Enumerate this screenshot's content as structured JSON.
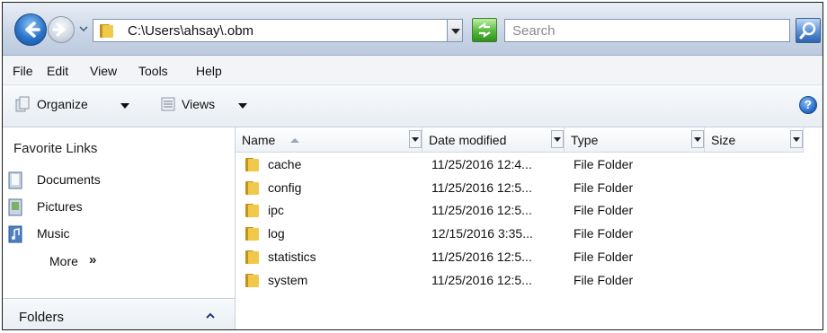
{
  "address_bar": {
    "path": "C:\\Users\\ahsay\\.obm",
    "search_placeholder": "Search"
  },
  "menu": [
    "File",
    "Edit",
    "View",
    "Tools",
    "Help"
  ],
  "toolbar": {
    "organize_label": "Organize",
    "views_label": "Views"
  },
  "nav_pane": {
    "favorites_title": "Favorite Links",
    "links": [
      "Documents",
      "Pictures",
      "Music"
    ],
    "more_label": "More",
    "more_chevron": "»",
    "folders_label": "Folders"
  },
  "columns": [
    "Name",
    "Date modified",
    "Type",
    "Size"
  ],
  "files": [
    {
      "name": "cache",
      "date": "11/25/2016 12:4...",
      "type": "File Folder"
    },
    {
      "name": "config",
      "date": "11/25/2016 12:5...",
      "type": "File Folder"
    },
    {
      "name": "ipc",
      "date": "11/25/2016 12:5...",
      "type": "File Folder"
    },
    {
      "name": "log",
      "date": "12/15/2016 3:35...",
      "type": "File Folder"
    },
    {
      "name": "statistics",
      "date": "11/25/2016 12:5...",
      "type": "File Folder"
    },
    {
      "name": "system",
      "date": "11/25/2016 12:5...",
      "type": "File Folder"
    }
  ],
  "colors": {
    "chrome_top": "#e9eef5",
    "chrome_bottom": "#bccadf",
    "folder": "#e8b830",
    "accent_blue": "#2a73c8"
  }
}
